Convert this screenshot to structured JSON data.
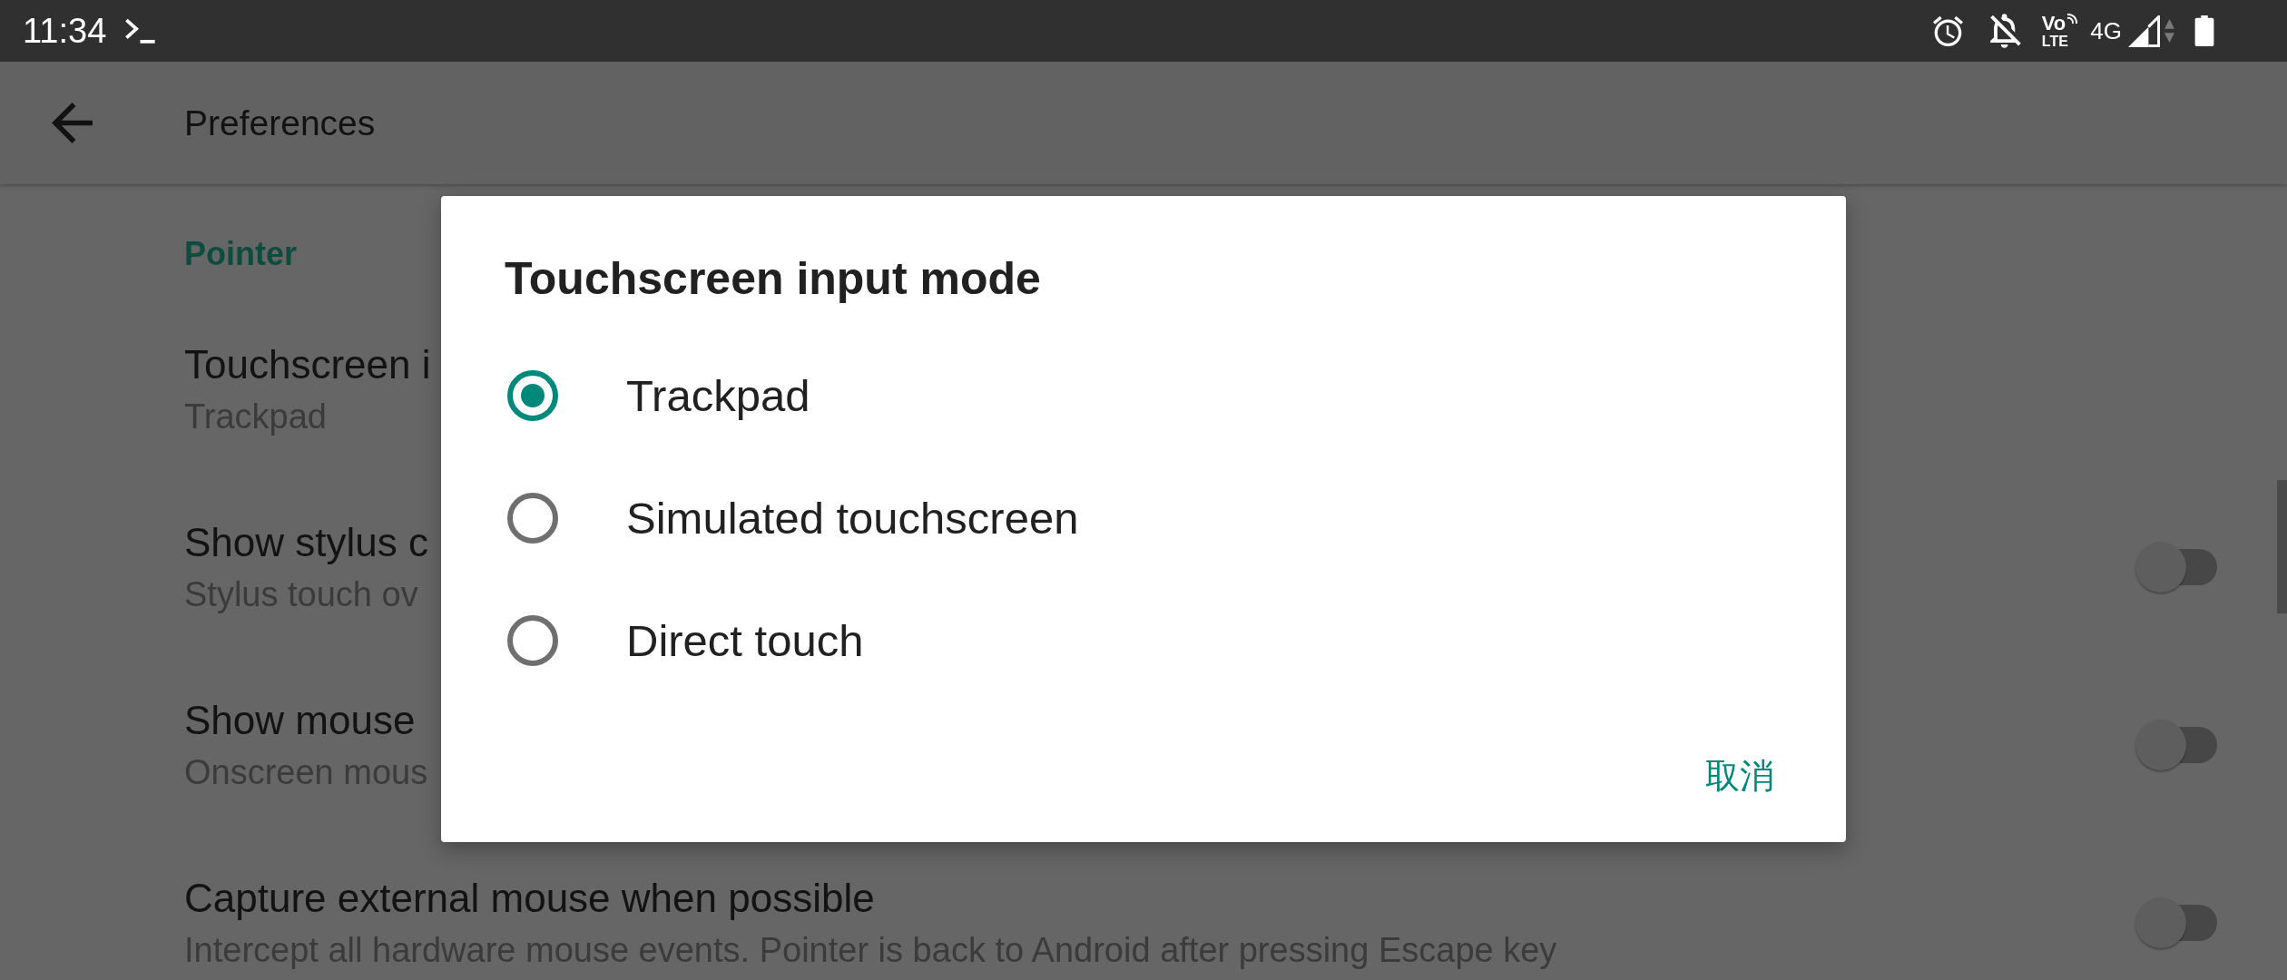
{
  "status_bar": {
    "time": "11:34",
    "volte_top": "Vo",
    "volte_bottom": "LTE",
    "network": "4G"
  },
  "app_bar": {
    "title": "Preferences"
  },
  "settings": {
    "section": "Pointer",
    "items": [
      {
        "kind": "choice",
        "title": "Touchscreen i",
        "summary": "Trackpad"
      },
      {
        "kind": "toggle",
        "title": "Show stylus c",
        "summary": "Stylus touch ov",
        "on": false
      },
      {
        "kind": "toggle",
        "title": "Show mouse",
        "summary": "Onscreen mous",
        "on": false
      },
      {
        "kind": "toggle",
        "title": "Capture external mouse when possible",
        "summary": "Intercept all hardware mouse events. Pointer is back to Android after pressing Escape key",
        "on": false
      }
    ]
  },
  "dialog": {
    "title": "Touchscreen input mode",
    "options": [
      {
        "label": "Trackpad",
        "selected": true
      },
      {
        "label": "Simulated touchscreen",
        "selected": false
      },
      {
        "label": "Direct touch",
        "selected": false
      }
    ],
    "cancel_button": "取消"
  }
}
